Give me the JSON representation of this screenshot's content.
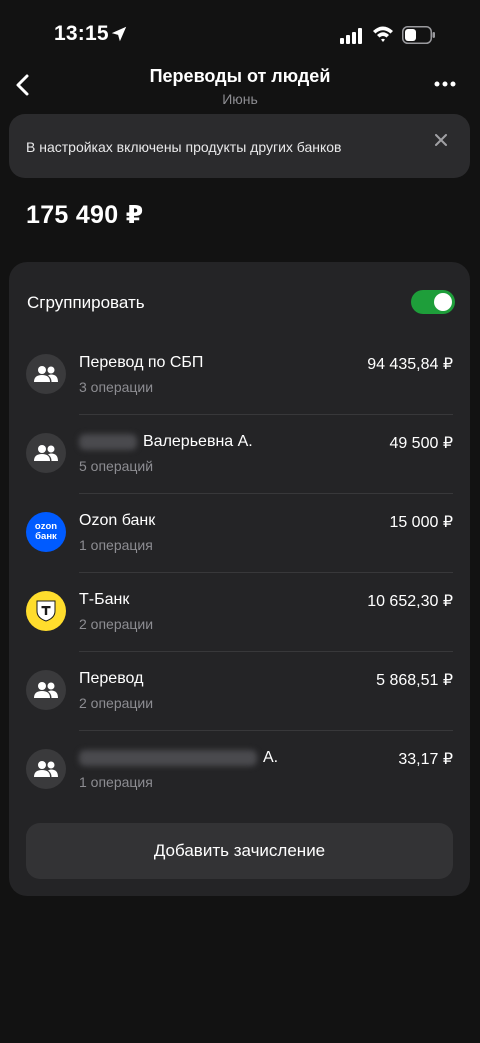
{
  "status_bar": {
    "time": "13:15"
  },
  "nav": {
    "title": "Переводы от людей",
    "subtitle": "Июнь"
  },
  "banner": {
    "text": "В настройках включены продукты других банков"
  },
  "total": {
    "amount": "175 490 ₽"
  },
  "grouping": {
    "label": "Сгруппировать",
    "enabled": true
  },
  "transfers": [
    {
      "title": "Перевод по СБП",
      "subtitle": "3 операции",
      "amount": "94 435,84 ₽",
      "icon": "people-icon"
    },
    {
      "title": "Валерьевна А.",
      "subtitle": "5 операций",
      "amount": "49 500 ₽",
      "icon": "people-icon"
    },
    {
      "title": "Ozon банк",
      "subtitle": "1 операция",
      "amount": "15 000 ₽",
      "icon": "ozon-bank-logo"
    },
    {
      "title": "Т-Банк",
      "subtitle": "2 операции",
      "amount": "10 652,30 ₽",
      "icon": "tbank-logo"
    },
    {
      "title": "Перевод",
      "subtitle": "2 операции",
      "amount": "5 868,51 ₽",
      "icon": "people-icon"
    },
    {
      "title": "А.",
      "subtitle": "1 операция",
      "amount": "33,17 ₽",
      "icon": "people-icon"
    }
  ],
  "ozon_logo_text": [
    "ozon",
    "банк"
  ],
  "add_button": {
    "label": "Добавить зачисление"
  },
  "colors": {
    "background": "#121212",
    "card": "#242426",
    "toggle_on": "#1e9e3a",
    "ozon_blue": "#005bff",
    "tbank_yellow": "#ffdd2d"
  }
}
